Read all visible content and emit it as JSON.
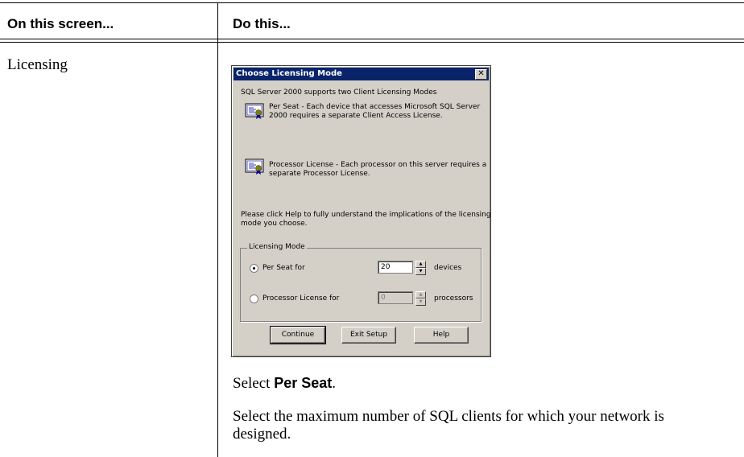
{
  "table": {
    "col1_header": "On this screen...",
    "col2_header": "Do this...",
    "row_label": "Licensing",
    "instruction_prefix": "Select ",
    "instruction_bold": "Per Seat",
    "instruction_suffix": ".",
    "instruction2": "Select the maximum number of SQL clients for which your network is designed."
  },
  "dialog": {
    "title": "Choose Licensing Mode",
    "close_glyph": "✕",
    "intro": "SQL Server 2000  supports two Client Licensing Modes",
    "per_seat_desc_line1": "Per Seat - Each device that accesses Microsoft SQL Server",
    "per_seat_desc_line2": "2000 requires a separate Client Access License.",
    "processor_desc_line1": "Processor License - Each processor on this server requires a",
    "processor_desc_line2": "separate Processor License.",
    "help_note_line1": "Please click Help to fully understand the implications of the licensing",
    "help_note_line2": "mode you choose.",
    "group_label": "Licensing Mode",
    "per_seat_label": "Per Seat for",
    "per_seat_value": "20",
    "per_seat_unit": "devices",
    "processor_label": "Processor License for",
    "processor_value": "0",
    "processor_unit": "processors",
    "selected_mode": "Per Seat",
    "continue_label": "Continue",
    "exit_label": "Exit Setup",
    "help_label": "Help"
  },
  "colors": {
    "titlebar": "#0a246a",
    "dialog_bg": "#d4d0c8"
  }
}
